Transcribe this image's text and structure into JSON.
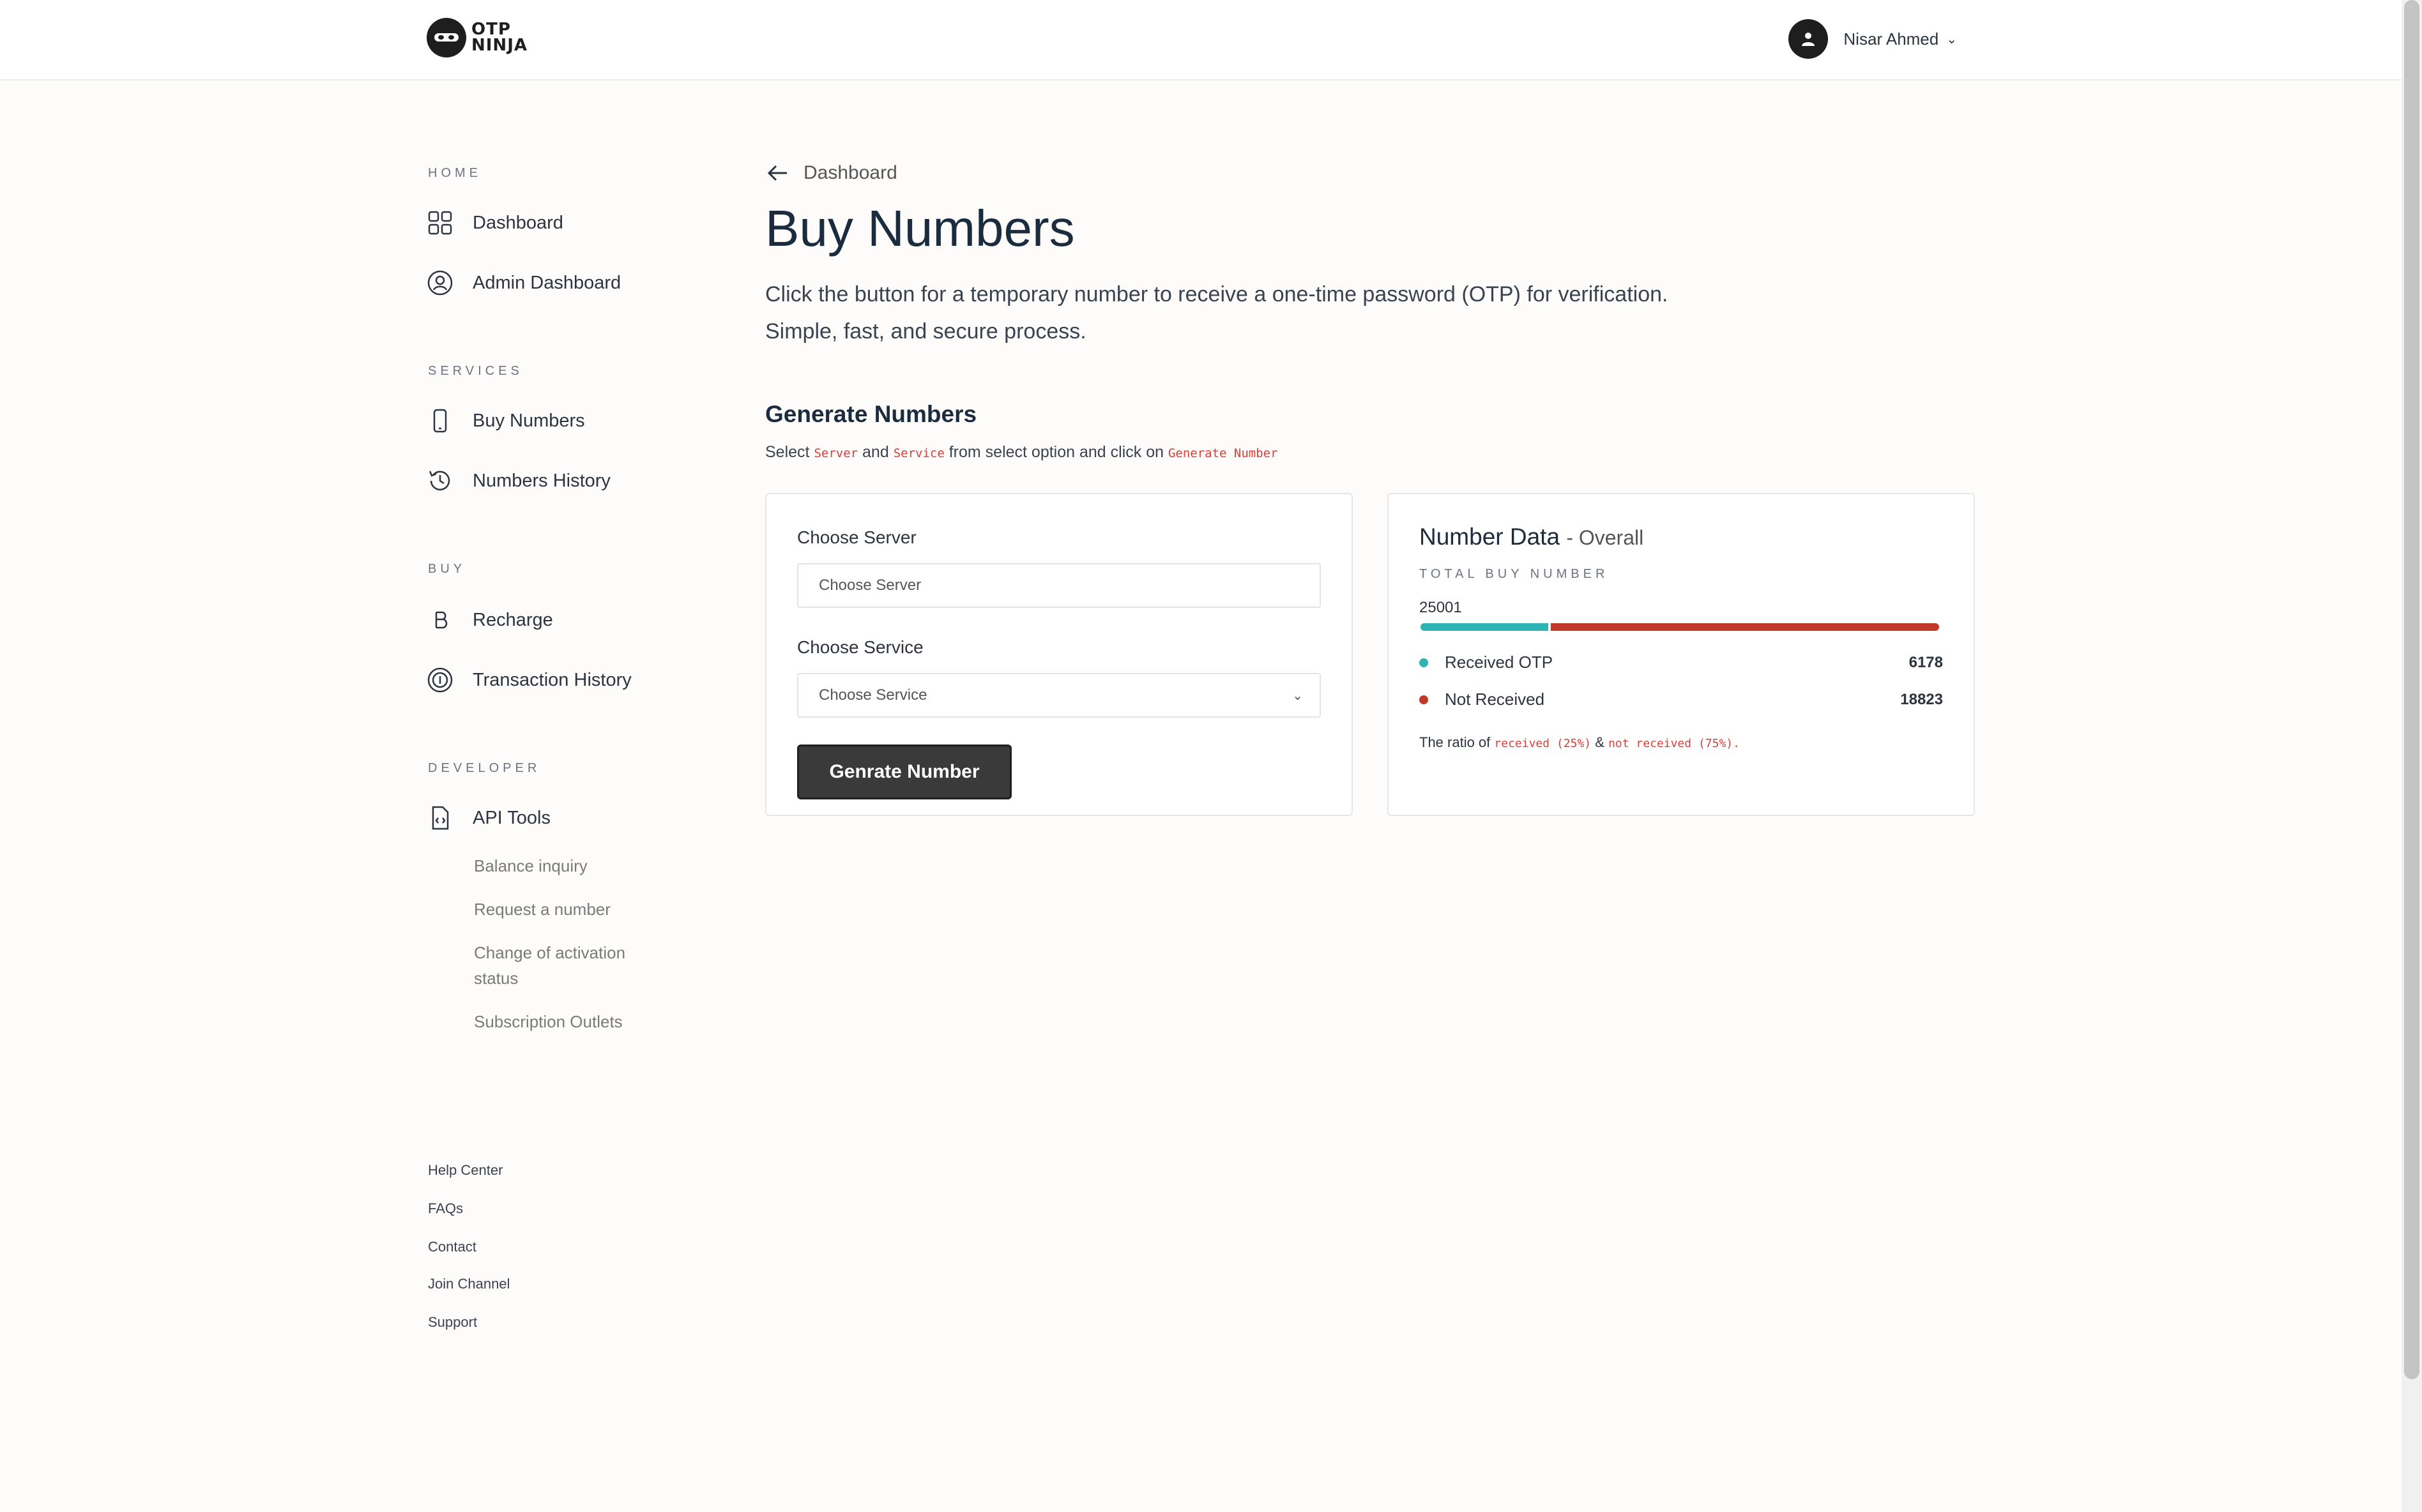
{
  "header": {
    "logo_text_line1": "OTP",
    "logo_text_line2": "NINJA",
    "user_name": "Nisar Ahmed",
    "user_caret": "⌄",
    "avatar_icon": "user-icon"
  },
  "sidebar": {
    "sections": {
      "home": "HOME",
      "services": "SERVICES",
      "buy": "BUY",
      "developer": "DEVELOPER"
    },
    "items": {
      "dashboard": "Dashboard",
      "admin_dashboard": "Admin Dashboard",
      "buy_numbers": "Buy Numbers",
      "numbers_history": "Numbers History",
      "recharge": "Recharge",
      "transaction_history": "Transaction History",
      "api_tools": "API Tools"
    },
    "api_subitems": {
      "balance_inquiry": "Balance inquiry",
      "request_number": "Request a number",
      "change_activation": "Change of activation status",
      "subscription_outlets": "Subscription Outlets"
    },
    "footer_links": {
      "help_center": "Help Center",
      "faqs": "FAQs",
      "contact": "Contact",
      "join_channel": "Join Channel",
      "support": "Support"
    }
  },
  "main": {
    "back_label": "Dashboard",
    "title": "Buy Numbers",
    "description": "Click the button for a temporary number to receive a one-time password (OTP) for verification. Simple, fast, and secure process.",
    "generate_title": "Generate Numbers",
    "hint": {
      "select": "Select",
      "server": "Server",
      "and": "and",
      "service": "Service",
      "from": "from select option and click on",
      "action": "Generate Number"
    },
    "form": {
      "server_label": "Choose Server",
      "server_placeholder": "Choose Server",
      "service_label": "Choose Service",
      "service_placeholder": "Choose Service",
      "service_caret": "⌄",
      "button_label": "Genrate Number"
    },
    "number_data": {
      "title": "Number Data",
      "subtitle": "- Overall",
      "total_label": "TOTAL BUY NUMBER",
      "total_value": "25001",
      "received_label": "Received OTP",
      "received_value": "6178",
      "received_fraction": 0.247,
      "not_received_label": "Not Received",
      "not_received_value": "18823",
      "ratio_prefix": "The ratio of",
      "ratio_received": "received (25%)",
      "ratio_amp": "&",
      "ratio_not_received": "not received (75%)."
    },
    "colors": {
      "received": "#2fb4b4",
      "not_received": "#c0392b",
      "accent_red": "#d8403a",
      "button_bg": "#3a3a3a"
    }
  }
}
